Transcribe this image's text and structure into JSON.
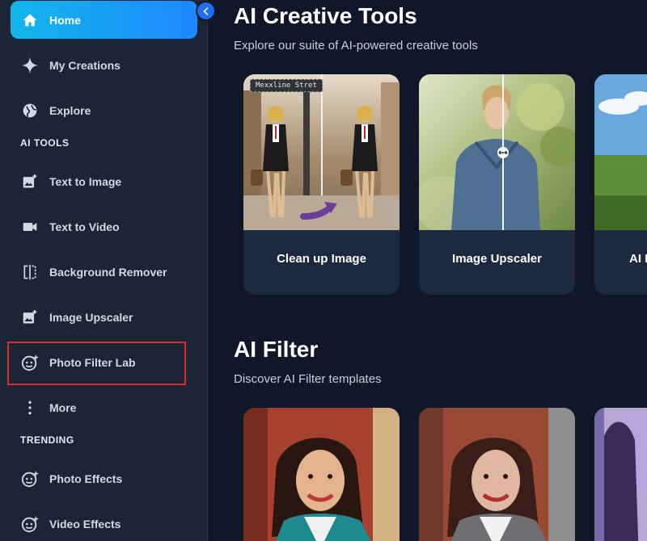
{
  "sidebar": {
    "nav": [
      {
        "label": "Home",
        "icon": "home-icon"
      },
      {
        "label": "My Creations",
        "icon": "sparkle-icon"
      },
      {
        "label": "Explore",
        "icon": "globe-icon"
      }
    ],
    "sections": {
      "ai_tools": "AI TOOLS",
      "trending": "TRENDING"
    },
    "ai_tools": [
      {
        "label": "Text to Image",
        "icon": "image-plus-icon"
      },
      {
        "label": "Text to Video",
        "icon": "video-camera-icon"
      },
      {
        "label": "Background Remover",
        "icon": "background-remover-icon"
      },
      {
        "label": "Image Upscaler",
        "icon": "image-plus-icon"
      },
      {
        "label": "Photo Filter Lab",
        "icon": "face-sparkle-icon"
      },
      {
        "label": "More",
        "icon": "more-vertical-icon"
      }
    ],
    "trending": [
      {
        "label": "Photo Effects",
        "icon": "face-sparkle-icon"
      },
      {
        "label": "Video Effects",
        "icon": "face-sparkle-icon"
      }
    ]
  },
  "main": {
    "creative": {
      "title": "AI Creative Tools",
      "subtitle": "Explore our suite of AI-powered creative tools",
      "cards": [
        {
          "title": "Clean up Image",
          "tag": "Mexxline Stret"
        },
        {
          "title": "Image Upscaler"
        },
        {
          "title": "AI I"
        }
      ]
    },
    "filter": {
      "title": "AI Filter",
      "subtitle": "Discover AI Filter templates"
    }
  },
  "colors": {
    "background": "#101728",
    "sidebar": "#1c2536",
    "accent": "#1e88ff",
    "highlight": "#e3282d"
  }
}
